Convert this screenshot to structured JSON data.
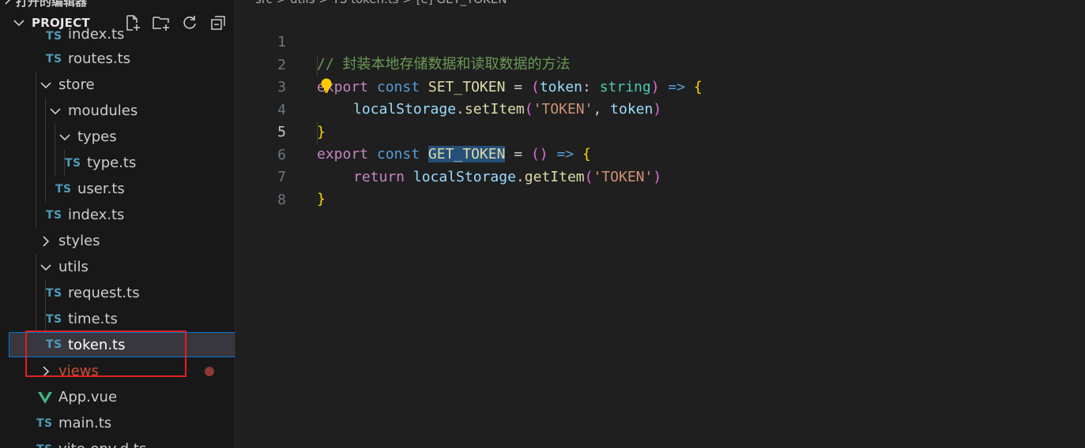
{
  "sidebar": {
    "section_cut_title": "打开的编辑器",
    "project_title": "PROJECT",
    "type_badge": "TS",
    "items": {
      "index_cut": "index.ts",
      "routes": "routes.ts",
      "store": "store",
      "moudules": "moudules",
      "types": "types",
      "type": "type.ts",
      "user": "user.ts",
      "index": "index.ts",
      "styles": "styles",
      "utils": "utils",
      "request": "request.ts",
      "time": "time.ts",
      "token": "token.ts",
      "views": "views",
      "app": "App.vue",
      "main": "main.ts",
      "vite_env": "vite-env.d.ts"
    }
  },
  "breadcrumb": {
    "text": "src > utils > TS token.ts > [e] GET_TOKEN"
  },
  "editor": {
    "line_numbers": [
      "1",
      "2",
      "3",
      "4",
      "5",
      "6",
      "7",
      "8"
    ],
    "active_line": 5,
    "tokens": {
      "comment": "// 封装本地存储数据和读取数据的方法",
      "export": "export",
      "const": "const",
      "set_token": "SET_TOKEN",
      "get_token": "GET_TOKEN",
      "eq": " = ",
      "open_paren": "(",
      "close_paren": ")",
      "empty_parens": "()",
      "token": "token",
      "colon": ": ",
      "string_type": "string",
      "arrow": " => ",
      "open_brace": "{",
      "close_brace": "}",
      "local_storage": "localStorage",
      "dot": ".",
      "set_item": "setItem",
      "get_item": "getItem",
      "token_str": "'TOKEN'",
      "comma": ", ",
      "return": "return"
    }
  },
  "colors": {
    "accent": "#0078d4",
    "modified": "#c74e39",
    "highlight_box": "#e02020"
  }
}
